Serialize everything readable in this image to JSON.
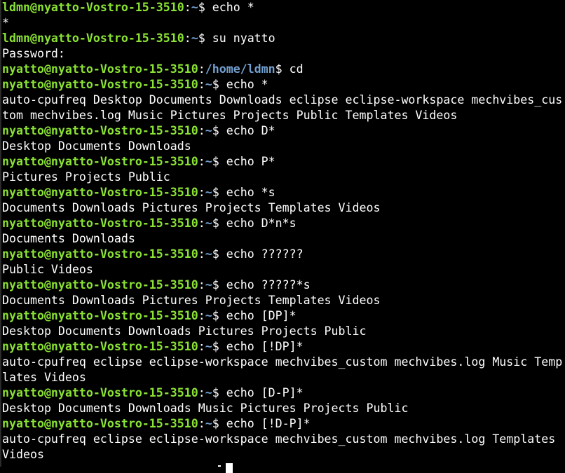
{
  "terminal": {
    "lines": [
      {
        "kind": "prompt",
        "user": "ldmn@nyatto-Vostro-15-3510",
        "path": "~",
        "dollar": "$",
        "cmd": " echo *"
      },
      {
        "kind": "output",
        "text": "*"
      },
      {
        "kind": "prompt",
        "user": "ldmn@nyatto-Vostro-15-3510",
        "path": "~",
        "dollar": "$",
        "cmd": " su nyatto"
      },
      {
        "kind": "output",
        "text": "Password:"
      },
      {
        "kind": "prompt",
        "user": "nyatto@nyatto-Vostro-15-3510",
        "path": "/home/ldmn",
        "dollar": "$",
        "cmd": " cd"
      },
      {
        "kind": "prompt",
        "user": "nyatto@nyatto-Vostro-15-3510",
        "path": "~",
        "dollar": "$",
        "cmd": " echo *"
      },
      {
        "kind": "output",
        "text": "auto-cpufreq Desktop Documents Downloads eclipse eclipse-workspace mechvibes_cus"
      },
      {
        "kind": "output",
        "text": "tom mechvibes.log Music Pictures Projects Public Templates Videos"
      },
      {
        "kind": "prompt",
        "user": "nyatto@nyatto-Vostro-15-3510",
        "path": "~",
        "dollar": "$",
        "cmd": " echo D*"
      },
      {
        "kind": "output",
        "text": "Desktop Documents Downloads"
      },
      {
        "kind": "prompt",
        "user": "nyatto@nyatto-Vostro-15-3510",
        "path": "~",
        "dollar": "$",
        "cmd": " echo P*"
      },
      {
        "kind": "output",
        "text": "Pictures Projects Public"
      },
      {
        "kind": "prompt",
        "user": "nyatto@nyatto-Vostro-15-3510",
        "path": "~",
        "dollar": "$",
        "cmd": " echo *s"
      },
      {
        "kind": "output",
        "text": "Documents Downloads Pictures Projects Templates Videos"
      },
      {
        "kind": "prompt",
        "user": "nyatto@nyatto-Vostro-15-3510",
        "path": "~",
        "dollar": "$",
        "cmd": " echo D*n*s"
      },
      {
        "kind": "output",
        "text": "Documents Downloads"
      },
      {
        "kind": "prompt",
        "user": "nyatto@nyatto-Vostro-15-3510",
        "path": "~",
        "dollar": "$",
        "cmd": " echo ??????"
      },
      {
        "kind": "output",
        "text": "Public Videos"
      },
      {
        "kind": "prompt",
        "user": "nyatto@nyatto-Vostro-15-3510",
        "path": "~",
        "dollar": "$",
        "cmd": " echo ?????*s"
      },
      {
        "kind": "output",
        "text": "Documents Downloads Pictures Projects Templates Videos"
      },
      {
        "kind": "prompt",
        "user": "nyatto@nyatto-Vostro-15-3510",
        "path": "~",
        "dollar": "$",
        "cmd": " echo [DP]*"
      },
      {
        "kind": "output",
        "text": "Desktop Documents Downloads Pictures Projects Public"
      },
      {
        "kind": "prompt",
        "user": "nyatto@nyatto-Vostro-15-3510",
        "path": "~",
        "dollar": "$",
        "cmd": " echo [!DP]*"
      },
      {
        "kind": "output",
        "text": "auto-cpufreq eclipse eclipse-workspace mechvibes_custom mechvibes.log Music Temp"
      },
      {
        "kind": "output",
        "text": "lates Videos"
      },
      {
        "kind": "prompt",
        "user": "nyatto@nyatto-Vostro-15-3510",
        "path": "~",
        "dollar": "$",
        "cmd": " echo [D-P]*"
      },
      {
        "kind": "output",
        "text": "Desktop Documents Downloads Music Pictures Projects Public"
      },
      {
        "kind": "prompt",
        "user": "nyatto@nyatto-Vostro-15-3510",
        "path": "~",
        "dollar": "$",
        "cmd": " echo [!D-P]*"
      },
      {
        "kind": "output",
        "text": "auto-cpufreq eclipse eclipse-workspace mechvibes_custom mechvibes.log Templates"
      },
      {
        "kind": "output",
        "text": "Videos"
      }
    ]
  },
  "colors": {
    "background": "#000000",
    "prompt_user": "#8ae234",
    "prompt_path": "#729fcf",
    "text": "#ffffff"
  }
}
